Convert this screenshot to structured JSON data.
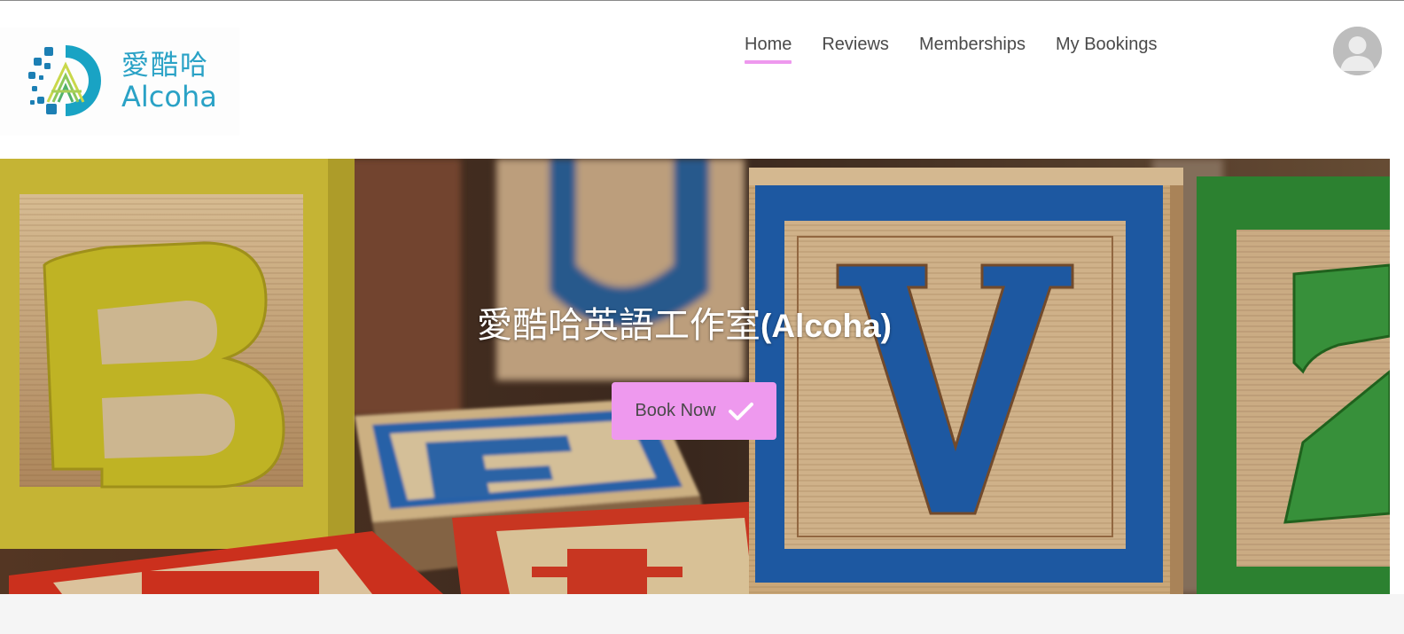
{
  "brand": {
    "logo_cn": "愛酷哈",
    "logo_en": "Alcoha",
    "color": "#2aa2c6"
  },
  "nav": {
    "items": [
      {
        "label": "Home",
        "active": true
      },
      {
        "label": "Reviews",
        "active": false
      },
      {
        "label": "Memberships",
        "active": false
      },
      {
        "label": "My Bookings",
        "active": false
      }
    ],
    "active_underline_color": "#ee99ee"
  },
  "account": {
    "icon": "user-avatar-icon"
  },
  "hero": {
    "title_cn": "愛酷哈英語工作室",
    "title_en": "(Alcoha)",
    "background": "wooden-alphabet-blocks-photo",
    "cta": {
      "label": "Book Now",
      "icon": "check-icon",
      "color": "#ee99ee"
    }
  }
}
